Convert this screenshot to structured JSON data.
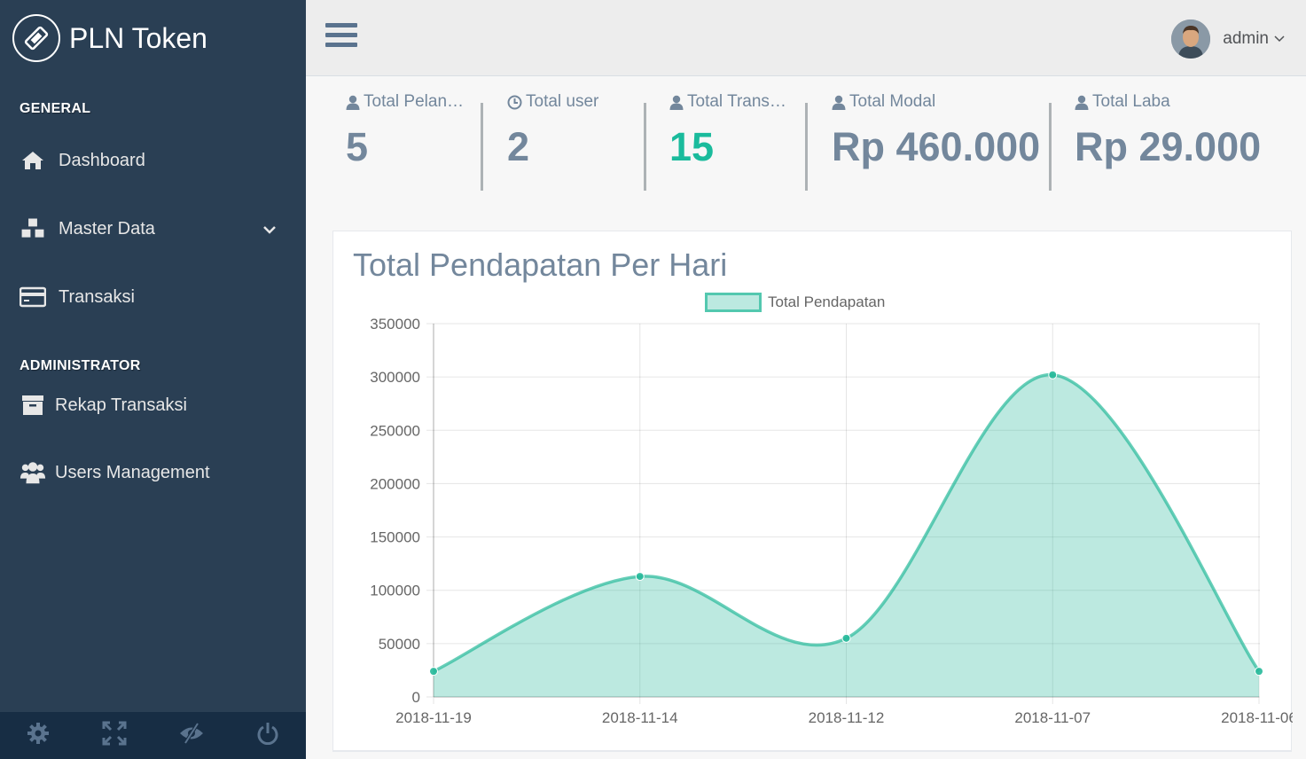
{
  "app": {
    "title": "PLN Token"
  },
  "sidebar": {
    "sections": [
      {
        "title": "GENERAL"
      },
      {
        "title": "ADMINISTRATOR"
      }
    ],
    "items": [
      {
        "label": "Dashboard",
        "icon": "home-icon"
      },
      {
        "label": "Master Data",
        "icon": "cubes-icon",
        "has_submenu": true
      },
      {
        "label": "Transaksi",
        "icon": "credit-card-icon"
      },
      {
        "label": "Rekap Transaksi",
        "icon": "archive-icon"
      },
      {
        "label": "Users Management",
        "icon": "users-icon"
      }
    ],
    "footer_icons": [
      "settings-icon",
      "fullscreen-icon",
      "lock-icon",
      "power-icon"
    ]
  },
  "header": {
    "user_name": "admin"
  },
  "tiles": [
    {
      "label": "Total Pelan…",
      "value": "5",
      "icon": "user-icon"
    },
    {
      "label": "Total user",
      "value": "2",
      "icon": "clock-icon"
    },
    {
      "label": "Total Trans…",
      "value": "15",
      "icon": "user-icon",
      "highlight": true
    },
    {
      "label": "Total Modal",
      "value": "Rp 460.000",
      "icon": "user-icon"
    },
    {
      "label": "Total Laba",
      "value": "Rp 29.000",
      "icon": "user-icon"
    }
  ],
  "panel": {
    "title": "Total Pendapatan Per Hari"
  },
  "colors": {
    "sidebar": "#2a3f54",
    "accent": "#1abb9c",
    "line": "#26b99a",
    "text": "#73879c"
  },
  "chart_data": {
    "type": "area",
    "x": [
      "2018-11-19",
      "2018-11-14",
      "2018-11-12",
      "2018-11-07",
      "2018-11-06"
    ],
    "series": [
      {
        "name": "Total Pendapatan",
        "values": [
          24000,
          113000,
          55000,
          302000,
          24000
        ]
      }
    ],
    "ylim": [
      0,
      350000
    ],
    "yticks": [
      "350000",
      "300000",
      "250000",
      "200000",
      "150000",
      "100000",
      "50000",
      "0"
    ],
    "grid": true,
    "legend": "top-center"
  }
}
